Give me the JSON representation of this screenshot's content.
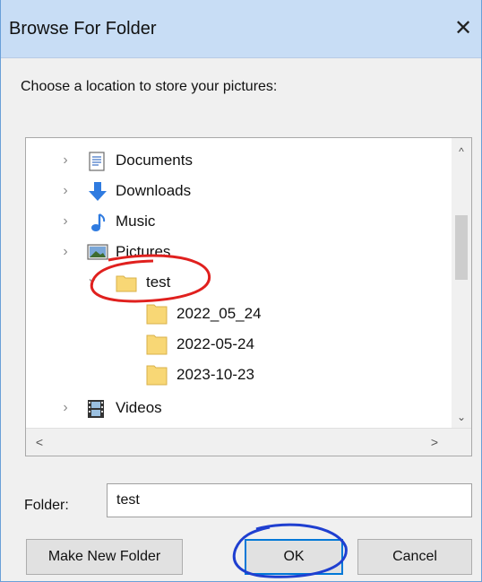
{
  "dialog": {
    "title": "Browse For Folder",
    "close_glyph": "✕",
    "prompt": "Choose a location to store your pictures:"
  },
  "tree": {
    "items": [
      {
        "label": "Documents",
        "icon": "documents-icon",
        "expander": "›",
        "selected": false
      },
      {
        "label": "Downloads",
        "icon": "downloads-icon",
        "expander": "›",
        "selected": false
      },
      {
        "label": "Music",
        "icon": "music-icon",
        "expander": "›",
        "selected": false
      },
      {
        "label": "Pictures",
        "icon": "pictures-icon",
        "expander": "›",
        "selected": false
      },
      {
        "label": "test",
        "icon": "folder-icon",
        "expander": "⌄",
        "selected": true
      },
      {
        "label": "2022_05_24",
        "icon": "folder-icon",
        "expander": "",
        "selected": false
      },
      {
        "label": "2022-05-24",
        "icon": "folder-icon",
        "expander": "",
        "selected": false
      },
      {
        "label": "2023-10-23",
        "icon": "folder-icon",
        "expander": "",
        "selected": false
      },
      {
        "label": "Videos",
        "icon": "videos-icon",
        "expander": "›",
        "selected": false
      }
    ],
    "scroll_up_glyph": "^",
    "scroll_down_glyph": "⌄",
    "scroll_left_glyph": "<",
    "scroll_right_glyph": ">"
  },
  "folder_field": {
    "label": "Folder:",
    "value": "test"
  },
  "buttons": {
    "make_new_folder": "Make New Folder",
    "ok": "OK",
    "cancel": "Cancel"
  },
  "colors": {
    "titlebar": "#c8ddf5",
    "accent": "#0078d7",
    "folder": "#f8d775",
    "annotation_red": "#e0201e",
    "annotation_blue": "#1f3fd0"
  }
}
